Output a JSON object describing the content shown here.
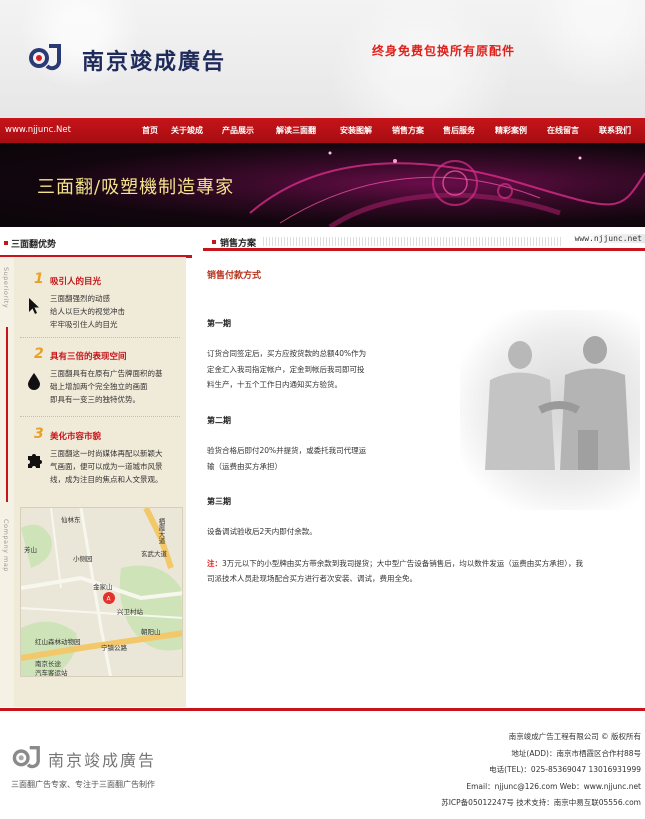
{
  "header": {
    "brand": "南京竣成廣告",
    "slogan": "终身免费包换所有原配件"
  },
  "nav": {
    "url": "www.njjunc.Net",
    "items": [
      "首页",
      "关于竣成",
      "产品展示",
      "解读三面翻",
      "安装图解",
      "销售方案",
      "售后服务",
      "精彩案例",
      "在线留言",
      "联系我们"
    ]
  },
  "banner": {
    "text": "三面翻/吸塑機制造專家"
  },
  "left": {
    "title": "三面翻优势",
    "vertical_top": "Superiority",
    "vertical_bottom": "Company map",
    "sections": [
      {
        "num": "1",
        "head": "吸引人的目光",
        "icon": "cursor-icon",
        "body": [
          "三面翻强烈的动感",
          "给人以巨大的视觉冲击",
          "牢牢吸引住人的目光"
        ]
      },
      {
        "num": "2",
        "head": "具有三倍的表现空间",
        "icon": "drop-icon",
        "body": [
          "三面翻具有在原有广告牌面积的基",
          "础上增加两个完全独立的画面",
          "即具有一变三的独特优势。"
        ]
      },
      {
        "num": "3",
        "head": "美化市容市貌",
        "icon": "puzzle-icon",
        "body": [
          "三面翻这一时尚媒体再配以新颖大",
          "气画面，便可以成为一道城市风景",
          "线，成为注目的焦点和人文景观。"
        ]
      }
    ],
    "map_labels": [
      "仙林东",
      "芳山",
      "小侧园",
      "金家山",
      "兴卫村站",
      "朝阳山",
      "红山森林动物园",
      "宁镇公路",
      "南京长途",
      "汽车客运站",
      "栖霞大道",
      "玄武大道"
    ]
  },
  "right": {
    "title": "销售方案",
    "site_tag": "www.njjunc.net",
    "content_title": "销售付款方式",
    "phases": [
      {
        "label": "第一期",
        "text": [
          "订货合同签定后，买方应按货款的总额40%作为",
          "定金汇入我司指定帐户，定金到帐后我司即可投",
          "料生产，十五个工作日内通知买方验货。"
        ]
      },
      {
        "label": "第二期",
        "text": [
          "验货合格后即付20%并提货，或委托我司代理运",
          "输（运费由买方承担）"
        ]
      },
      {
        "label": "第三期",
        "text": [
          "设备调试验收后2天内即付余款。"
        ]
      }
    ],
    "note_label": "注：",
    "note_line1": "3万元以下的小型牌由买方带余款到我司提货；大中型广告设备销售后，均以数件发运（运费由买方承担），我",
    "note_line2": "司派技术人员赴现场配合买方进行者次安装、调试，费用全免。"
  },
  "footer": {
    "brand": "南京竣成廣告",
    "tagline": "三面翻广告专家、专注于三面翻广告制作",
    "lines": [
      "南京竣成广告工程有限公司 © 版权所有",
      "地址(ADD)：南京市栖霞区合作村88号",
      "电话(TEL)：025-85369047 13016931999",
      "Email：njjunc@126.com Web：www.njjunc.net",
      "苏ICP备05012247号  技术支持：南京中易互联05556.com"
    ]
  },
  "colors": {
    "brand_red": "#c6141a",
    "accent_orange": "#e8a02a",
    "slogan_red": "#e0201a"
  }
}
